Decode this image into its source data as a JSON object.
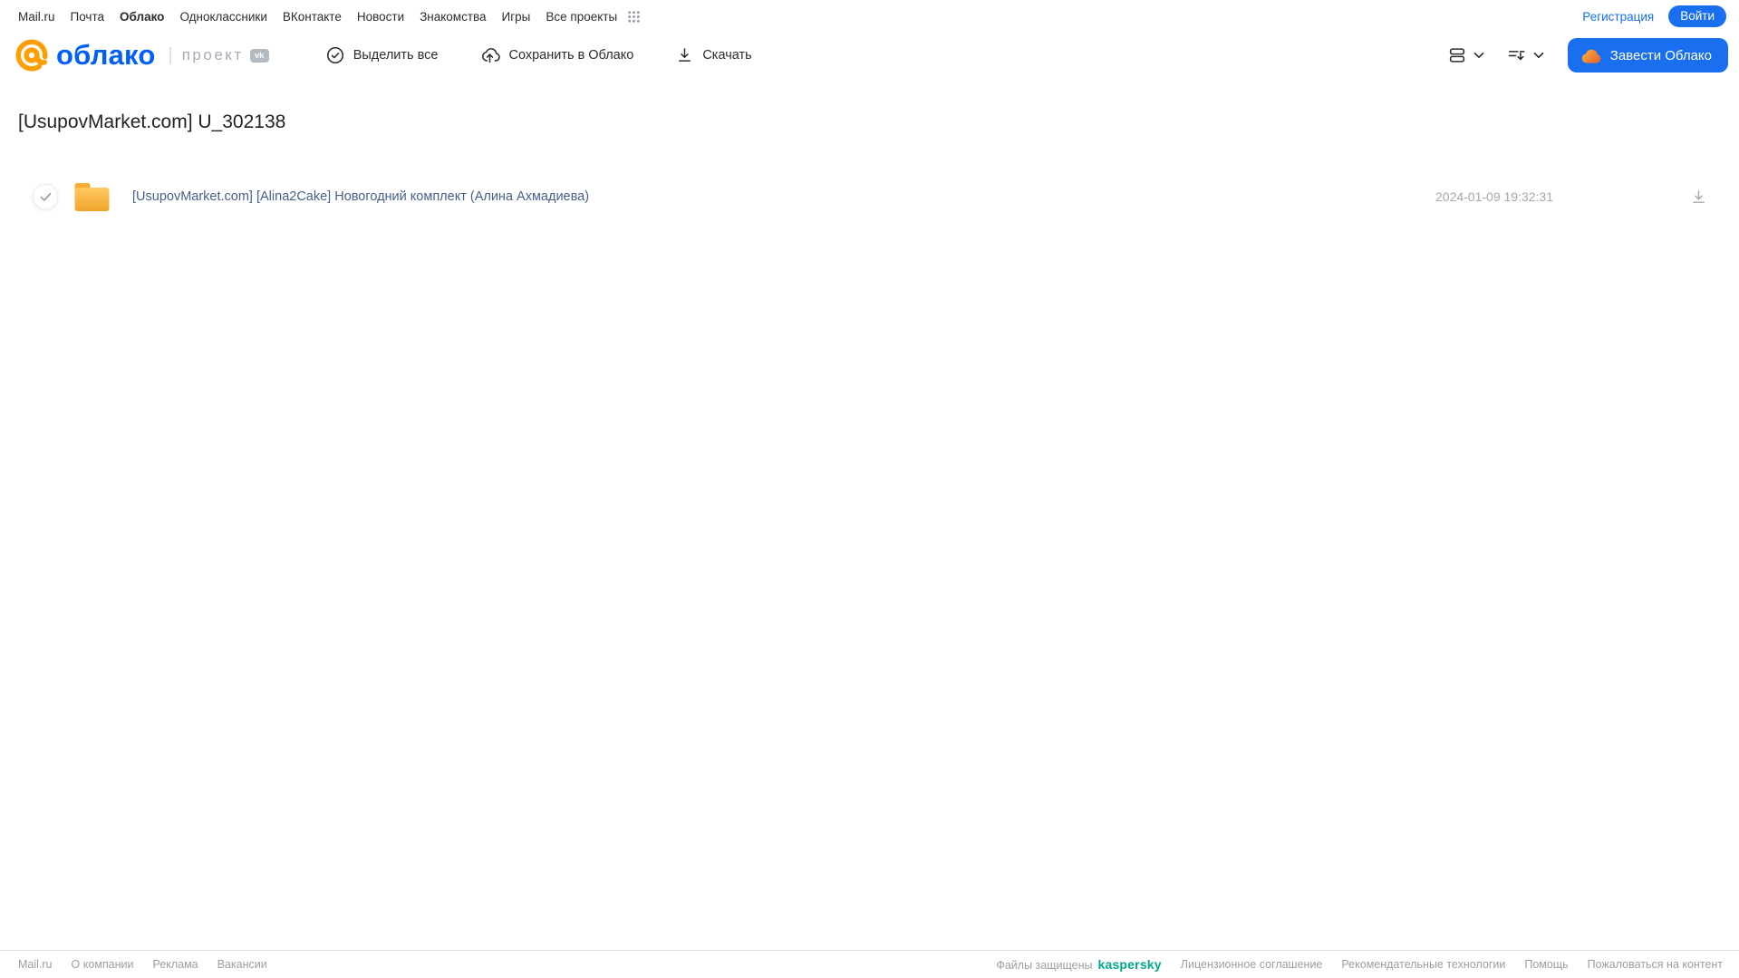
{
  "top_nav": {
    "links": [
      "Mail.ru",
      "Почта",
      "Облако",
      "Одноклассники",
      "ВКонтакте",
      "Новости",
      "Знакомства",
      "Игры",
      "Все проекты"
    ],
    "active_link": "Облако",
    "register_label": "Регистрация",
    "login_label": "Войти"
  },
  "header": {
    "logo_text": "облако",
    "project_label": "проект",
    "vk_badge": "vk",
    "toolbar": {
      "select_all": "Выделить все",
      "save_to_cloud": "Сохранить в Облако",
      "download": "Скачать"
    },
    "get_cloud_button": "Завести Облако"
  },
  "page": {
    "title": "[UsupovMarket.com] U_302138"
  },
  "files": [
    {
      "type": "folder",
      "name": "[UsupovMarket.com] [Alina2Cake] Новогодний комплект (Алина Ахмадиева)",
      "date": "2024-01-09 19:32:31"
    }
  ],
  "footer": {
    "left_links": [
      "Mail.ru",
      "О компании",
      "Реклама",
      "Вакансии"
    ],
    "protected_label": "Файлы защищены",
    "kaspersky_label": "kaspersky",
    "right_links": [
      "Лицензионное соглашение",
      "Рекомендательные технологии",
      "Помощь",
      "Пожаловаться на контент"
    ]
  },
  "colors": {
    "accent_blue": "#1a6ef0",
    "logo_blue": "#005FF9",
    "logo_orange": "#FF9E00",
    "kaspersky_green": "#00a88e",
    "folder_yellow": "#F6A62B"
  }
}
